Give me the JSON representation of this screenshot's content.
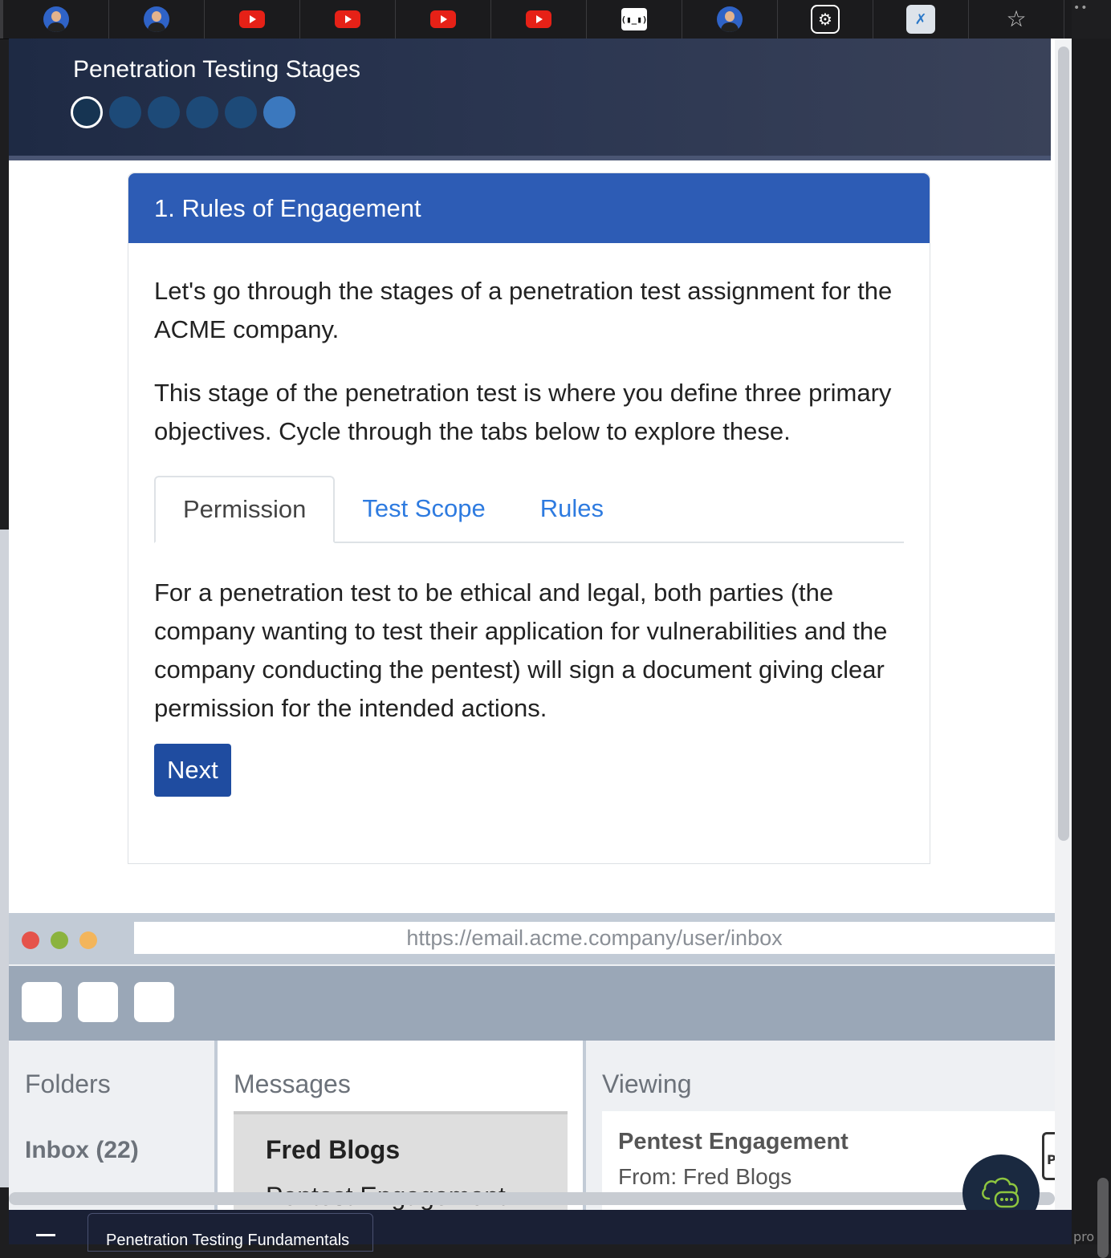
{
  "browser": {
    "tabs": [
      {
        "icon": "avatar-icon"
      },
      {
        "icon": "avatar-icon"
      },
      {
        "icon": "youtube-icon"
      },
      {
        "icon": "youtube-icon"
      },
      {
        "icon": "youtube-icon"
      },
      {
        "icon": "youtube-icon"
      },
      {
        "icon": "robot-icon",
        "glyph": "(▮_▮)"
      },
      {
        "icon": "avatar-icon"
      },
      {
        "icon": "openai-icon",
        "glyph": "⚙"
      },
      {
        "icon": "x-extension-icon",
        "glyph": "✗"
      },
      {
        "icon": "star-icon",
        "glyph": "☆"
      }
    ],
    "menu_dots": "••"
  },
  "stage": {
    "title": "Penetration Testing Stages",
    "steps_total": 6,
    "current_step": 1
  },
  "card": {
    "title": "1. Rules of Engagement",
    "intro": "Let's go through the stages of a penetration test assignment for the ACME company.",
    "description": "This stage of the penetration test is where you define three primary objectives. Cycle through the tabs below to explore these.",
    "tabs": [
      {
        "label": "Permission",
        "active": true
      },
      {
        "label": "Test Scope",
        "active": false
      },
      {
        "label": "Rules",
        "active": false
      }
    ],
    "tab_content": "For a penetration test to be ethical and legal, both parties (the company wanting to test their application for vulnerabilities and the company conducting the pentest) will sign a document giving clear permission for the intended actions.",
    "next_label": "Next"
  },
  "email_mock": {
    "url": "https://email.acme.company/user/inbox",
    "folders_heading": "Folders",
    "inbox_label": "Inbox (22)",
    "messages_heading": "Messages",
    "message_from": "Fred Blogs",
    "message_subject": "Pentest Engagement",
    "viewing_heading": "Viewing",
    "view_subject": "Pentest Engagement",
    "view_from": "From: Fred Blogs",
    "attachment_letter": "P"
  },
  "bottom": {
    "course_tab": "Penetration Testing Fundamentals",
    "right_text": "pro"
  },
  "colors": {
    "header_bg": "#1e2a44",
    "card_head": "#2d5cb5",
    "link": "#2e7be0",
    "button": "#1f4ca0"
  }
}
